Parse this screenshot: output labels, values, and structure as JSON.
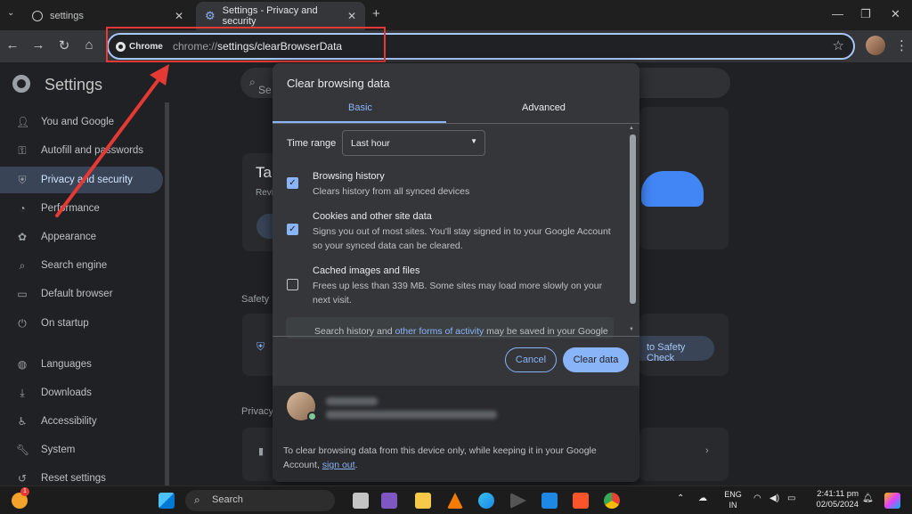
{
  "browser": {
    "tabs": [
      {
        "title": "settings",
        "active": false
      },
      {
        "title": "Settings - Privacy and security",
        "active": true
      }
    ],
    "chip_label": "Chrome",
    "url_prefix": "chrome://",
    "url_host": "settings",
    "url_path": "/clearBrowserData"
  },
  "settings": {
    "title": "Settings",
    "search_placeholder": "Se",
    "sidebar": [
      {
        "label": "You and Google",
        "icon": "person-icon"
      },
      {
        "label": "Autofill and passwords",
        "icon": "key-icon"
      },
      {
        "label": "Privacy and security",
        "icon": "shield-icon",
        "active": true
      },
      {
        "label": "Performance",
        "icon": "speedometer-icon"
      },
      {
        "label": "Appearance",
        "icon": "palette-icon"
      },
      {
        "label": "Search engine",
        "icon": "search-icon"
      },
      {
        "label": "Default browser",
        "icon": "browser-icon"
      },
      {
        "label": "On startup",
        "icon": "power-icon"
      },
      {
        "label": "Languages",
        "icon": "globe-icon"
      },
      {
        "label": "Downloads",
        "icon": "download-icon"
      },
      {
        "label": "Accessibility",
        "icon": "accessibility-icon"
      },
      {
        "label": "System",
        "icon": "wrench-icon"
      },
      {
        "label": "Reset settings",
        "icon": "reset-icon"
      }
    ],
    "bg_card_title": "Tal",
    "bg_card_sub": "Revi",
    "safety_section": "Safety",
    "privacy_section": "Privacy",
    "safety_check_button": "to Safety Check"
  },
  "dialog": {
    "title": "Clear browsing data",
    "tabs": [
      "Basic",
      "Advanced"
    ],
    "time_range_label": "Time range",
    "time_range_value": "Last hour",
    "options": [
      {
        "title": "Browsing history",
        "desc": "Clears history from all synced devices",
        "checked": true
      },
      {
        "title": "Cookies and other site data",
        "desc": "Signs you out of most sites. You'll stay signed in to your Google Account so your synced data can be cleared.",
        "checked": true
      },
      {
        "title": "Cached images and files",
        "desc": "Frees up less than 339 MB. Some sites may load more slowly on your next visit.",
        "checked": false
      }
    ],
    "info_text_a": "Search history",
    "info_text_b": " and ",
    "info_text_c": "other forms of activity",
    "info_text_d": " may be saved in your Google",
    "cancel_label": "Cancel",
    "clear_label": "Clear data",
    "footer_text": "To clear browsing data from this device only, while keeping it in your Google Account, ",
    "footer_link": "sign out",
    "footer_end": "."
  },
  "taskbar": {
    "search_label": "Search",
    "lang_top": "ENG",
    "lang_bottom": "IN",
    "time": "2:41:11 pm",
    "date": "02/05/2024",
    "notification_count": "1"
  },
  "colors": {
    "accent": "#8ab4f8",
    "annotation": "#e53935"
  }
}
